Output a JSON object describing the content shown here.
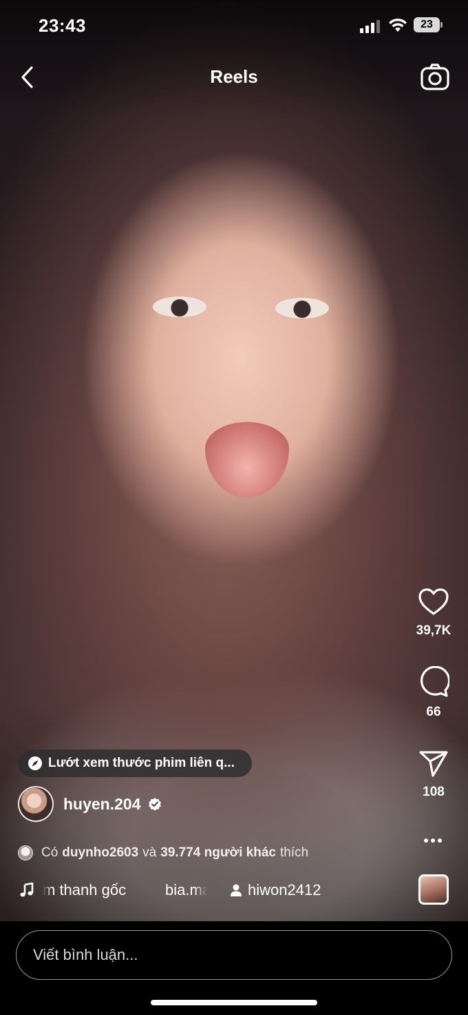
{
  "status_bar": {
    "time": "23:43",
    "battery": "23",
    "icons": [
      "cellular-signal-icon",
      "wifi-icon",
      "battery-icon"
    ]
  },
  "header": {
    "title": "Reels",
    "back_icon": "chevron-left-icon",
    "camera_icon": "camera-icon"
  },
  "actions": {
    "likes": "39,7K",
    "comments": "66",
    "shares": "108",
    "like_icon": "heart-icon",
    "comment_icon": "speech-bubble-icon",
    "share_icon": "paper-plane-icon",
    "more_icon": "more-horizontal-icon"
  },
  "caption": {
    "related_chip": "Lướt xem thước phim liên q...",
    "related_icon": "compass-icon",
    "username": "huyen.204",
    "verified_icon": "verified-badge-icon",
    "liked_by_prefix": "Có",
    "liked_by_user": "duynho2603",
    "liked_by_and": "và",
    "liked_by_others": "39.774 người khác",
    "liked_by_suffix": "thích",
    "audio_title": "m thanh gốc",
    "audio_owner": "bia.ma",
    "music_icon": "music-note-icon",
    "tagged_icon": "person-icon",
    "tagged_user": "hiwon2412"
  },
  "comment_bar": {
    "placeholder": "Viết bình luận..."
  },
  "colors": {
    "background": "#000000",
    "text": "#ffffff",
    "chip_bg": "#2d2d30"
  }
}
